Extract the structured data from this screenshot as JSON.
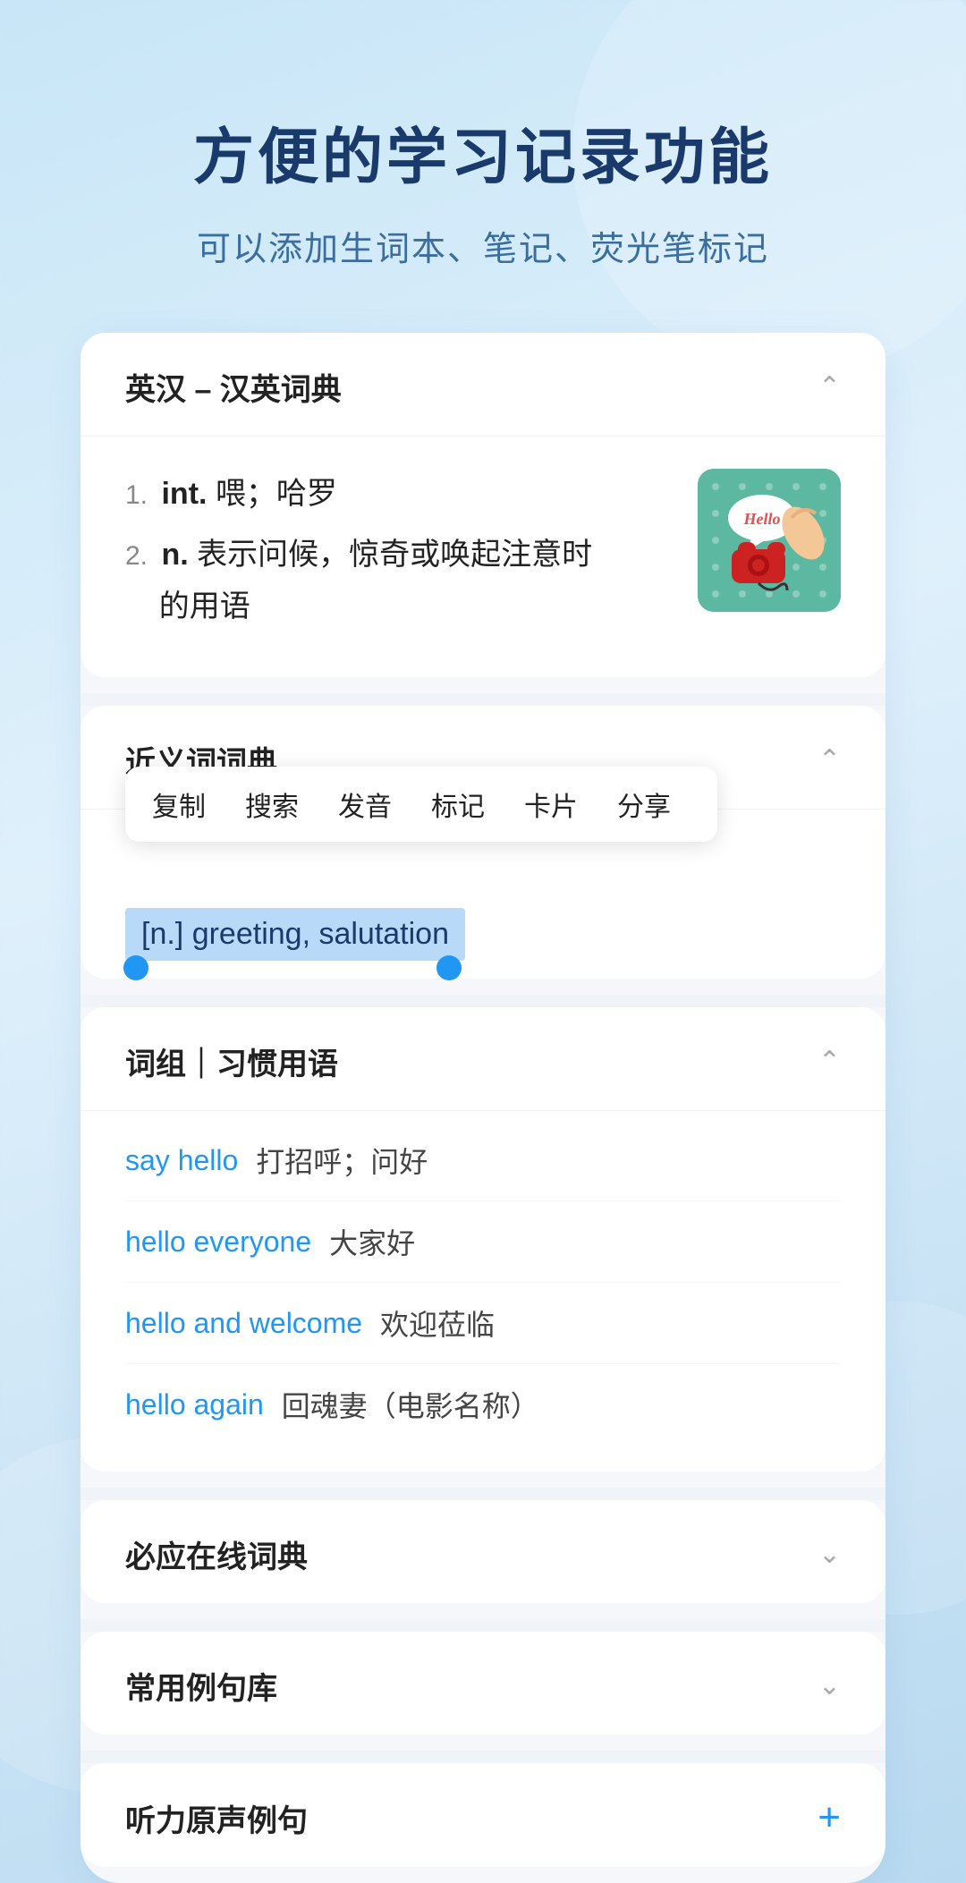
{
  "hero": {
    "title": "方便的学习记录功能",
    "subtitle": "可以添加生词本、笔记、荧光笔标记"
  },
  "sections": {
    "dictionary": {
      "title": "英汉 – 汉英词典",
      "definitions": [
        {
          "num": "1.",
          "pos": "int.",
          "text": "喂；哈罗"
        },
        {
          "num": "2.",
          "pos": "n.",
          "text": "表示问候，惊奇或唤起注意时的用语"
        }
      ]
    },
    "synonyms": {
      "title": "近义词词典",
      "context_menu": [
        "复制",
        "搜索",
        "发音",
        "标记",
        "卡片",
        "分享"
      ],
      "selected_text": "[n.] greeting, salutation"
    },
    "phrases": {
      "title": "词组｜习惯用语",
      "items": [
        {
          "en": "say hello",
          "cn": "打招呼；问好"
        },
        {
          "en": "hello everyone",
          "cn": "大家好"
        },
        {
          "en": "hello and welcome",
          "cn": "欢迎莅临"
        },
        {
          "en": "hello again",
          "cn": "回魂妻（电影名称）"
        }
      ]
    },
    "online_dict": {
      "title": "必应在线词典"
    },
    "sentence_lib": {
      "title": "常用例句库"
    },
    "listening": {
      "title": "听力原声例句"
    }
  },
  "icons": {
    "chevron_up": "∧",
    "chevron_down": "∨",
    "plus": "+"
  }
}
